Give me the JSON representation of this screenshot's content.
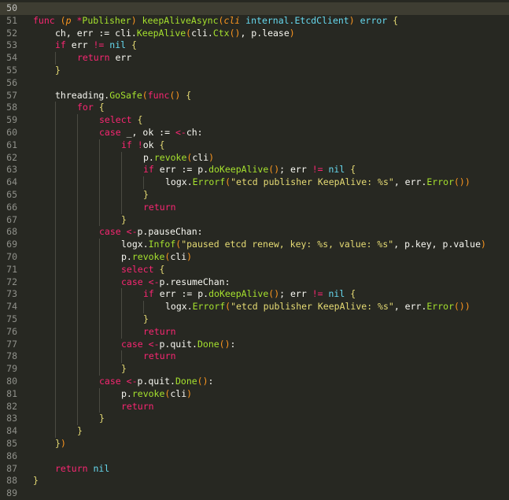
{
  "editor": {
    "current_line": 50,
    "theme": {
      "background": "#272822",
      "current_line_bg": "#3e3d32",
      "gutter_fg": "#8f908a",
      "keyword": "#f92672",
      "type": "#66d9ef",
      "function": "#a6e22e",
      "string": "#e6db74",
      "parameter": "#fd971f",
      "plain": "#f8f8f2"
    },
    "lines": [
      {
        "n": "50",
        "indent": 0,
        "tokens": []
      },
      {
        "n": "51",
        "indent": 0,
        "tokens": [
          [
            "keyword",
            "func"
          ],
          [
            "plain",
            " "
          ],
          [
            "paren",
            "("
          ],
          [
            "param",
            "p"
          ],
          [
            "plain",
            " "
          ],
          [
            "keyword",
            "*"
          ],
          [
            "func",
            "Publisher"
          ],
          [
            "paren",
            ")"
          ],
          [
            "plain",
            " "
          ],
          [
            "func",
            "keepAliveAsync"
          ],
          [
            "paren",
            "("
          ],
          [
            "param",
            "cli"
          ],
          [
            "plain",
            " "
          ],
          [
            "type",
            "internal.EtcdClient"
          ],
          [
            "paren",
            ")"
          ],
          [
            "plain",
            " "
          ],
          [
            "type",
            "error"
          ],
          [
            "plain",
            " "
          ],
          [
            "bracket",
            "{"
          ]
        ]
      },
      {
        "n": "52",
        "indent": 1,
        "tokens": [
          [
            "plain",
            "ch, err := cli."
          ],
          [
            "func",
            "KeepAlive"
          ],
          [
            "paren",
            "("
          ],
          [
            "plain",
            "cli."
          ],
          [
            "func",
            "Ctx"
          ],
          [
            "paren",
            "()"
          ],
          [
            "plain",
            ", p.lease"
          ],
          [
            "paren",
            ")"
          ]
        ]
      },
      {
        "n": "53",
        "indent": 1,
        "tokens": [
          [
            "keyword",
            "if"
          ],
          [
            "plain",
            " err "
          ],
          [
            "keyword",
            "!="
          ],
          [
            "plain",
            " "
          ],
          [
            "type",
            "nil"
          ],
          [
            "plain",
            " "
          ],
          [
            "bracket",
            "{"
          ]
        ]
      },
      {
        "n": "54",
        "indent": 2,
        "tokens": [
          [
            "keyword",
            "return"
          ],
          [
            "plain",
            " err"
          ]
        ]
      },
      {
        "n": "55",
        "indent": 1,
        "tokens": [
          [
            "bracket",
            "}"
          ]
        ]
      },
      {
        "n": "56",
        "indent": 0,
        "tokens": []
      },
      {
        "n": "57",
        "indent": 1,
        "tokens": [
          [
            "plain",
            "threading."
          ],
          [
            "func",
            "GoSafe"
          ],
          [
            "paren",
            "("
          ],
          [
            "keyword",
            "func"
          ],
          [
            "paren",
            "()"
          ],
          [
            "plain",
            " "
          ],
          [
            "bracket",
            "{"
          ]
        ]
      },
      {
        "n": "58",
        "indent": 2,
        "tokens": [
          [
            "keyword",
            "for"
          ],
          [
            "plain",
            " "
          ],
          [
            "bracket",
            "{"
          ]
        ]
      },
      {
        "n": "59",
        "indent": 3,
        "tokens": [
          [
            "keyword",
            "select"
          ],
          [
            "plain",
            " "
          ],
          [
            "bracket",
            "{"
          ]
        ]
      },
      {
        "n": "60",
        "indent": 3,
        "tokens": [
          [
            "keyword",
            "case"
          ],
          [
            "plain",
            " _, ok := "
          ],
          [
            "keyword",
            "<-"
          ],
          [
            "plain",
            "ch:"
          ]
        ]
      },
      {
        "n": "61",
        "indent": 4,
        "tokens": [
          [
            "keyword",
            "if"
          ],
          [
            "plain",
            " "
          ],
          [
            "keyword",
            "!"
          ],
          [
            "plain",
            "ok "
          ],
          [
            "bracket",
            "{"
          ]
        ]
      },
      {
        "n": "62",
        "indent": 5,
        "tokens": [
          [
            "plain",
            "p."
          ],
          [
            "func",
            "revoke"
          ],
          [
            "paren",
            "("
          ],
          [
            "plain",
            "cli"
          ],
          [
            "paren",
            ")"
          ]
        ]
      },
      {
        "n": "63",
        "indent": 5,
        "tokens": [
          [
            "keyword",
            "if"
          ],
          [
            "plain",
            " err := p."
          ],
          [
            "func",
            "doKeepAlive"
          ],
          [
            "paren",
            "()"
          ],
          [
            "plain",
            "; err "
          ],
          [
            "keyword",
            "!="
          ],
          [
            "plain",
            " "
          ],
          [
            "type",
            "nil"
          ],
          [
            "plain",
            " "
          ],
          [
            "bracket",
            "{"
          ]
        ]
      },
      {
        "n": "64",
        "indent": 6,
        "tokens": [
          [
            "plain",
            "logx."
          ],
          [
            "func",
            "Errorf"
          ],
          [
            "paren",
            "("
          ],
          [
            "string",
            "\"etcd publisher KeepAlive: %s\""
          ],
          [
            "plain",
            ", err."
          ],
          [
            "func",
            "Error"
          ],
          [
            "paren",
            "())"
          ]
        ]
      },
      {
        "n": "65",
        "indent": 5,
        "tokens": [
          [
            "bracket",
            "}"
          ]
        ]
      },
      {
        "n": "66",
        "indent": 5,
        "tokens": [
          [
            "keyword",
            "return"
          ]
        ]
      },
      {
        "n": "67",
        "indent": 4,
        "tokens": [
          [
            "bracket",
            "}"
          ]
        ]
      },
      {
        "n": "68",
        "indent": 3,
        "tokens": [
          [
            "keyword",
            "case"
          ],
          [
            "plain",
            " "
          ],
          [
            "keyword",
            "<-"
          ],
          [
            "plain",
            "p.pauseChan:"
          ]
        ]
      },
      {
        "n": "69",
        "indent": 4,
        "tokens": [
          [
            "plain",
            "logx."
          ],
          [
            "func",
            "Infof"
          ],
          [
            "paren",
            "("
          ],
          [
            "string",
            "\"paused etcd renew, key: %s, value: %s\""
          ],
          [
            "plain",
            ", p.key, p.value"
          ],
          [
            "paren",
            ")"
          ]
        ]
      },
      {
        "n": "70",
        "indent": 4,
        "tokens": [
          [
            "plain",
            "p."
          ],
          [
            "func",
            "revoke"
          ],
          [
            "paren",
            "("
          ],
          [
            "plain",
            "cli"
          ],
          [
            "paren",
            ")"
          ]
        ]
      },
      {
        "n": "71",
        "indent": 4,
        "tokens": [
          [
            "keyword",
            "select"
          ],
          [
            "plain",
            " "
          ],
          [
            "bracket",
            "{"
          ]
        ]
      },
      {
        "n": "72",
        "indent": 4,
        "tokens": [
          [
            "keyword",
            "case"
          ],
          [
            "plain",
            " "
          ],
          [
            "keyword",
            "<-"
          ],
          [
            "plain",
            "p.resumeChan:"
          ]
        ]
      },
      {
        "n": "73",
        "indent": 5,
        "tokens": [
          [
            "keyword",
            "if"
          ],
          [
            "plain",
            " err := p."
          ],
          [
            "func",
            "doKeepAlive"
          ],
          [
            "paren",
            "()"
          ],
          [
            "plain",
            "; err "
          ],
          [
            "keyword",
            "!="
          ],
          [
            "plain",
            " "
          ],
          [
            "type",
            "nil"
          ],
          [
            "plain",
            " "
          ],
          [
            "bracket",
            "{"
          ]
        ]
      },
      {
        "n": "74",
        "indent": 6,
        "tokens": [
          [
            "plain",
            "logx."
          ],
          [
            "func",
            "Errorf"
          ],
          [
            "paren",
            "("
          ],
          [
            "string",
            "\"etcd publisher KeepAlive: %s\""
          ],
          [
            "plain",
            ", err."
          ],
          [
            "func",
            "Error"
          ],
          [
            "paren",
            "())"
          ]
        ]
      },
      {
        "n": "75",
        "indent": 5,
        "tokens": [
          [
            "bracket",
            "}"
          ]
        ]
      },
      {
        "n": "76",
        "indent": 5,
        "tokens": [
          [
            "keyword",
            "return"
          ]
        ]
      },
      {
        "n": "77",
        "indent": 4,
        "tokens": [
          [
            "keyword",
            "case"
          ],
          [
            "plain",
            " "
          ],
          [
            "keyword",
            "<-"
          ],
          [
            "plain",
            "p.quit."
          ],
          [
            "func",
            "Done"
          ],
          [
            "paren",
            "()"
          ],
          [
            "plain",
            ":"
          ]
        ]
      },
      {
        "n": "78",
        "indent": 5,
        "tokens": [
          [
            "keyword",
            "return"
          ]
        ]
      },
      {
        "n": "79",
        "indent": 4,
        "tokens": [
          [
            "bracket",
            "}"
          ]
        ]
      },
      {
        "n": "80",
        "indent": 3,
        "tokens": [
          [
            "keyword",
            "case"
          ],
          [
            "plain",
            " "
          ],
          [
            "keyword",
            "<-"
          ],
          [
            "plain",
            "p.quit."
          ],
          [
            "func",
            "Done"
          ],
          [
            "paren",
            "()"
          ],
          [
            "plain",
            ":"
          ]
        ]
      },
      {
        "n": "81",
        "indent": 4,
        "tokens": [
          [
            "plain",
            "p."
          ],
          [
            "func",
            "revoke"
          ],
          [
            "paren",
            "("
          ],
          [
            "plain",
            "cli"
          ],
          [
            "paren",
            ")"
          ]
        ]
      },
      {
        "n": "82",
        "indent": 4,
        "tokens": [
          [
            "keyword",
            "return"
          ]
        ]
      },
      {
        "n": "83",
        "indent": 3,
        "tokens": [
          [
            "bracket",
            "}"
          ]
        ]
      },
      {
        "n": "84",
        "indent": 2,
        "tokens": [
          [
            "bracket",
            "}"
          ]
        ]
      },
      {
        "n": "85",
        "indent": 1,
        "tokens": [
          [
            "bracket",
            "}"
          ],
          [
            "paren",
            ")"
          ]
        ]
      },
      {
        "n": "86",
        "indent": 0,
        "tokens": []
      },
      {
        "n": "87",
        "indent": 1,
        "tokens": [
          [
            "keyword",
            "return"
          ],
          [
            "plain",
            " "
          ],
          [
            "type",
            "nil"
          ]
        ]
      },
      {
        "n": "88",
        "indent": 0,
        "tokens": [
          [
            "bracket",
            "}"
          ]
        ]
      },
      {
        "n": "89",
        "indent": 0,
        "tokens": []
      }
    ]
  }
}
